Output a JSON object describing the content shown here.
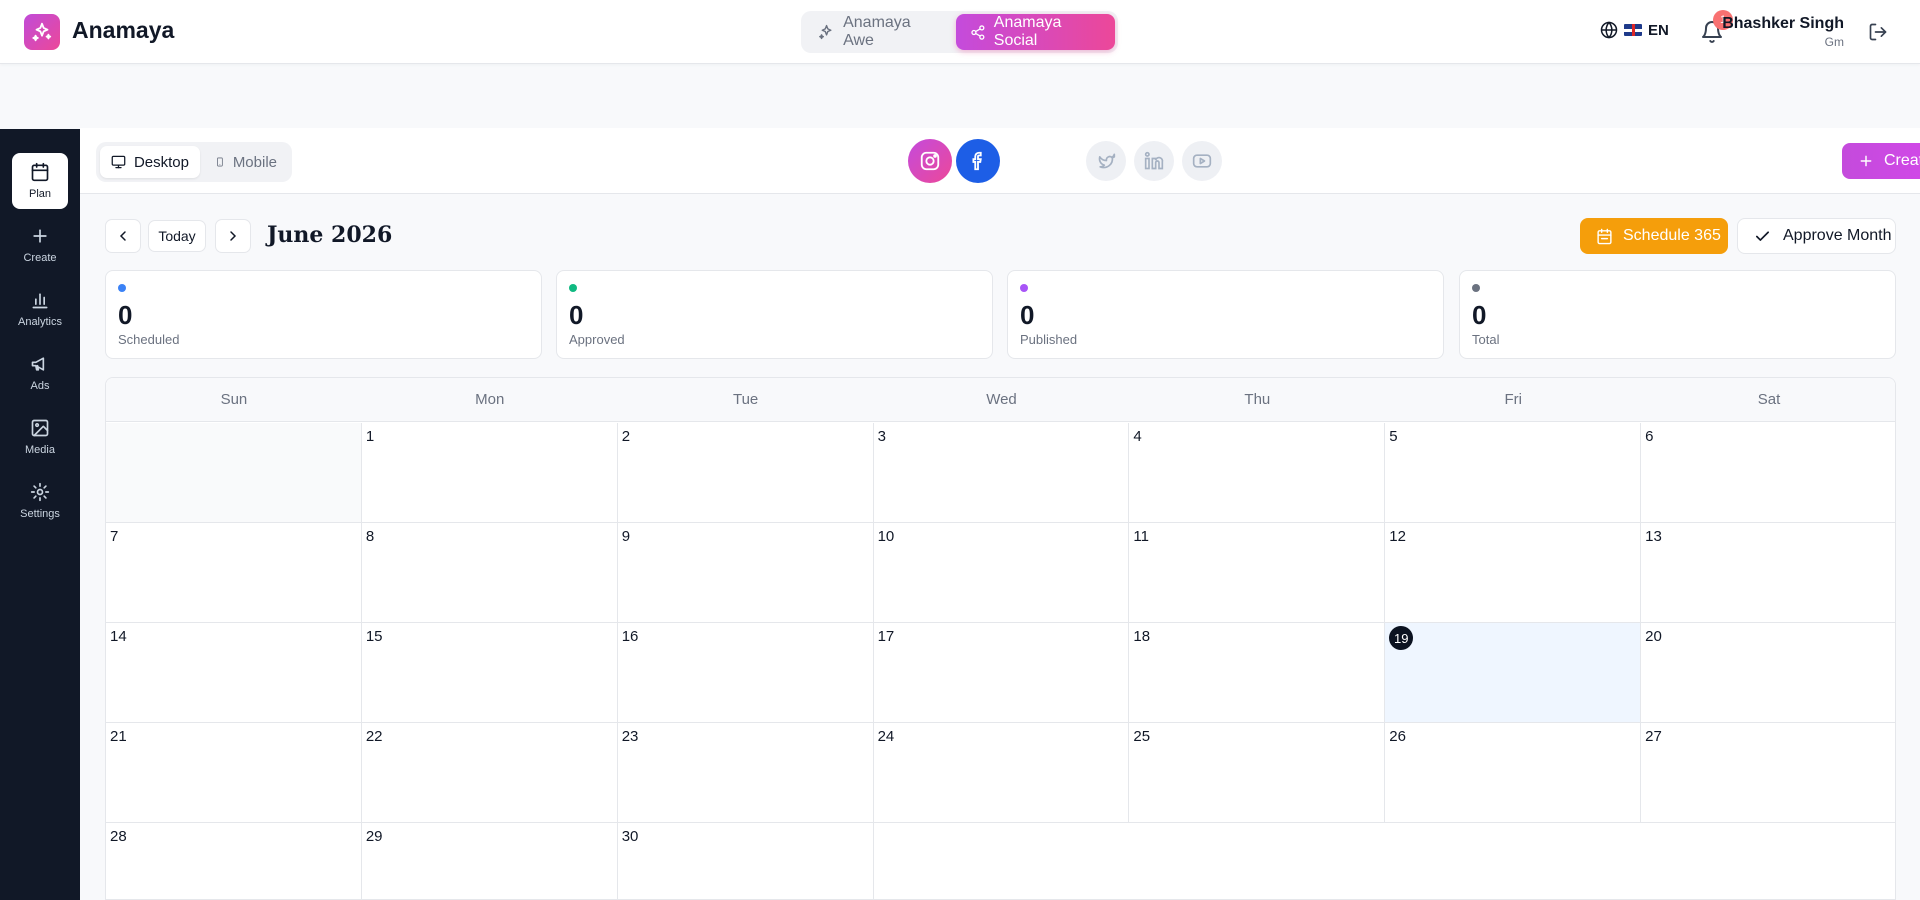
{
  "app": {
    "name": "Anamaya"
  },
  "header": {
    "switch": [
      {
        "label": "Anamaya Awe"
      },
      {
        "label": "Anamaya Social"
      }
    ],
    "language": "EN",
    "notifications_count": "1",
    "user": {
      "name": "Bhashker Singh",
      "sub": "Gm"
    }
  },
  "sidebar": {
    "items": [
      {
        "label": "Plan",
        "icon": "calendar-icon"
      },
      {
        "label": "Create",
        "icon": "plus-icon"
      },
      {
        "label": "Analytics",
        "icon": "bar-chart-icon"
      },
      {
        "label": "Ads",
        "icon": "megaphone-icon"
      },
      {
        "label": "Media",
        "icon": "image-icon"
      },
      {
        "label": "Settings",
        "icon": "gear-icon"
      }
    ]
  },
  "toolbar": {
    "device": {
      "desktop": "Desktop",
      "mobile": "Mobile"
    },
    "platforms": [
      "instagram",
      "facebook",
      "twitter",
      "linkedin",
      "youtube"
    ],
    "create_post": "Create Post"
  },
  "calendar_nav": {
    "today": "Today",
    "month": "June 2026",
    "schedule": "Schedule 365",
    "approve": "Approve Month"
  },
  "stats": [
    {
      "value": "0",
      "label": "Scheduled",
      "color": "#3b82f6"
    },
    {
      "value": "0",
      "label": "Approved",
      "color": "#10b981"
    },
    {
      "value": "0",
      "label": "Published",
      "color": "#a855f7"
    },
    {
      "value": "0",
      "label": "Total",
      "color": "#6b7280"
    }
  ],
  "calendar": {
    "weekdays": [
      "Sun",
      "Mon",
      "Tue",
      "Wed",
      "Thu",
      "Fri",
      "Sat"
    ],
    "first_weekday": 1,
    "days_in_month": 30,
    "today": 19
  },
  "colors": {
    "accent": "#d946ef",
    "schedule": "#f59e0b",
    "sidebar": "#111827",
    "instagram": "#e1306c",
    "facebook": "#1877f2"
  }
}
